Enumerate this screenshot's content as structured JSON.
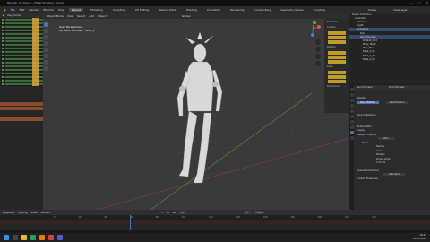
{
  "window": {
    "title": "Blender (C:\\Users\\...\\Fatal Shaders...blend)",
    "controls": [
      "—",
      "□",
      "✕"
    ]
  },
  "menubar": {
    "items": [
      "File",
      "Edit",
      "Render",
      "Window",
      "Help"
    ],
    "workspaces": [
      "Layout",
      "Modeling",
      "Sculpting",
      "UV Editing",
      "Texture Paint",
      "Shading",
      "Animation",
      "Rendering",
      "Compositing",
      "Geometry Nodes",
      "Scripting"
    ],
    "active_workspace": "Layout",
    "scene": "Scene",
    "view_layer": "ViewLayer"
  },
  "left_panel": {
    "header": "Keyframes"
  },
  "viewport": {
    "header_items": [
      "Object Mode",
      "View",
      "Select",
      "Add",
      "Object"
    ],
    "transform": "Global",
    "label_line1": "User Perspective",
    "label_line2": "(0) Sand Monster - Fatal_S"
  },
  "npanel": {
    "title": "Transform",
    "labels": [
      "Location",
      "X",
      "Y",
      "Z",
      "Rotation",
      "X",
      "Y",
      "Z",
      "Mode",
      "Scale",
      "X",
      "Y",
      "Z",
      "Dimensions"
    ]
  },
  "outliner": {
    "rows": [
      "Scene Collection",
      "Collection",
      "Camera",
      "Light",
      "Armature",
      "Pose",
      "Sand Monster",
      "Default_Slot",
      "Body_Mesh",
      "Hair_Mesh",
      "Fatal_S_01",
      "Fatal_S_02",
      "Fatal_S_03"
    ]
  },
  "properties": {
    "object_name": "Sand Monster",
    "data_name": "Sand Monster",
    "sections": [
      "Skeleton",
      "Pose Position",
      "Rest Position",
      "Bone Collections",
      "Motion Paths",
      "Display",
      "Viewport Display",
      "Show",
      "Names",
      "Axes",
      "Shapes",
      "Group Colors",
      "In Front",
      "Inverse Kinematics",
      "Custom Properties"
    ],
    "pose_position": "Pose Position",
    "rest_position": "Rest Position",
    "display_as": "Wire",
    "ik_solver": "Standard"
  },
  "timeline": {
    "header_items": [
      "Playback",
      "Keying",
      "View",
      "Marker"
    ],
    "ruler": [
      "0",
      "20",
      "40",
      "60",
      "80",
      "100",
      "120",
      "140",
      "160",
      "180",
      "200",
      "220",
      "240"
    ],
    "current_frame": "0",
    "start": "1",
    "end": "250"
  },
  "taskbar": {
    "time": "10:24",
    "date": "26-11-2023"
  }
}
